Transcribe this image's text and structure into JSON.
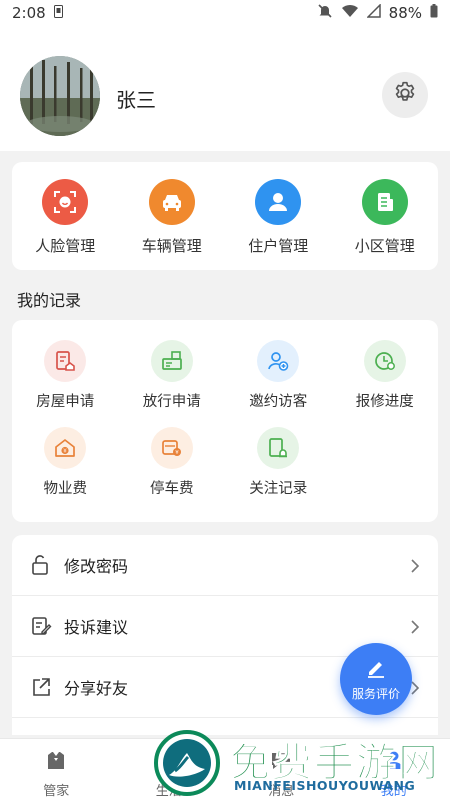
{
  "status_bar": {
    "time": "2:08",
    "battery": "88%"
  },
  "profile": {
    "name": "张三"
  },
  "quick_actions": [
    {
      "label": "人脸管理",
      "icon": "face-scan-icon",
      "color": "#ec5b45"
    },
    {
      "label": "车辆管理",
      "icon": "car-icon",
      "color": "#f0892e"
    },
    {
      "label": "住户管理",
      "icon": "resident-icon",
      "color": "#2f93f0"
    },
    {
      "label": "小区管理",
      "icon": "community-doc-icon",
      "color": "#3cb85b"
    }
  ],
  "records": {
    "title": "我的记录",
    "items": [
      {
        "label": "房屋申请",
        "icon": "house-application-icon",
        "color": "#d8534b",
        "bg": "#fbe9e7"
      },
      {
        "label": "放行申请",
        "icon": "release-pass-icon",
        "color": "#4caf50",
        "bg": "#e6f4e6"
      },
      {
        "label": "邀约访客",
        "icon": "invite-visitor-icon",
        "color": "#2f93f0",
        "bg": "#e3f0fd"
      },
      {
        "label": "报修进度",
        "icon": "repair-progress-icon",
        "color": "#4caf50",
        "bg": "#e6f4e6"
      },
      {
        "label": "物业费",
        "icon": "property-fee-icon",
        "color": "#e8823a",
        "bg": "#fdeee2"
      },
      {
        "label": "停车费",
        "icon": "parking-fee-icon",
        "color": "#e8823a",
        "bg": "#fdeee2"
      },
      {
        "label": "关注记录",
        "icon": "follow-record-icon",
        "color": "#4caf50",
        "bg": "#e6f4e6"
      }
    ]
  },
  "menu": [
    {
      "label": "修改密码",
      "icon": "lock-icon"
    },
    {
      "label": "投诉建议",
      "icon": "edit-note-icon"
    },
    {
      "label": "分享好友",
      "icon": "share-icon"
    }
  ],
  "fab": {
    "label": "服务评价",
    "icon": "pen-icon"
  },
  "tabs": [
    {
      "label": "管家",
      "icon": "butler-icon"
    },
    {
      "label": "生活",
      "icon": "life-icon"
    },
    {
      "label": "消息",
      "icon": "message-icon"
    },
    {
      "label": "我的",
      "icon": "profile-icon",
      "active": true
    }
  ],
  "watermark": {
    "title": "免费手游网",
    "subtitle": "MIANFEISHOUYOUWANG"
  },
  "colors": {
    "accent": "#3d7ef5",
    "background": "#f2f2f2"
  }
}
